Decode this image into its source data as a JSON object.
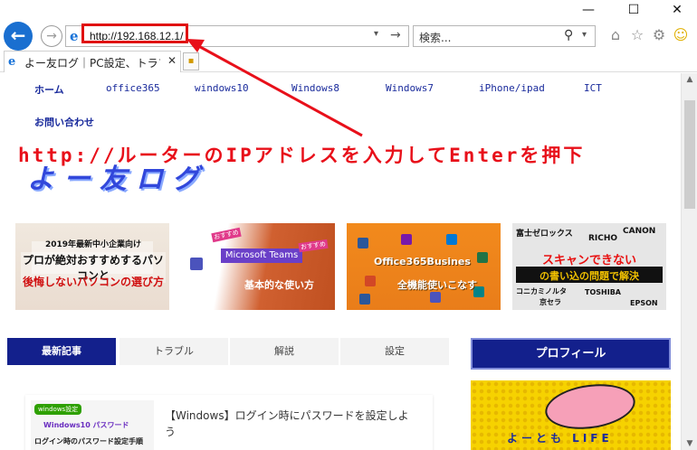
{
  "window": {
    "minimize": "—",
    "maximize": "☐",
    "close": "✕"
  },
  "toolbar": {
    "back": "←",
    "forward": "→",
    "url": "http://192.168.12.1/",
    "url_dropdown": "▾",
    "refresh": "→",
    "search_placeholder": "検索...",
    "search_icon": "⚲",
    "search_dropdown": "▾",
    "home_icon": "⌂",
    "favorites_icon": "☆",
    "settings_icon": "⚙",
    "feedback_icon": "☺"
  },
  "tab": {
    "title": "よー友ログ｜PC設定、トラブル...",
    "close": "✕",
    "new_tab": "▪"
  },
  "nav": {
    "items": [
      "ホーム",
      "office365",
      "windows10",
      "Windows8",
      "Windows7",
      "iPhone/ipad",
      "ICT"
    ],
    "contact": "お問い合わせ"
  },
  "annotation": {
    "text": "http://ルーターのIPアドレスを入力してEnterを押下",
    "color": "#e8101a"
  },
  "logo": {
    "text": "よー友ログ"
  },
  "thumbnails": {
    "t1": {
      "line1": "2019年最新中小企業向け",
      "line2": "プロが絶対おすすめするパソコンと",
      "line3": "後悔しないパソコンの選び方"
    },
    "t2": {
      "tag1": "おすすめ",
      "title": "Microsoft Teams",
      "tag2": "おすすめ",
      "subtitle": "基本的な使い方"
    },
    "t3": {
      "title": "Office365Busines",
      "subtitle": "全機能使いこなす"
    },
    "t4": {
      "brand1": "富士ゼロックス",
      "brand2": "RICHO",
      "brand3": "CANON",
      "title": "スキャンできない",
      "subtitle": "の書い込の問題で解決",
      "brand4": "コニカミノルタ",
      "brand5": "TOSHIBA",
      "brand6": "京セラ",
      "brand7": "EPSON"
    }
  },
  "content_tabs": [
    "最新記事",
    "トラブル",
    "解説",
    "設定"
  ],
  "profile": {
    "title": "プロフィール",
    "image_text": "よーとも LIFE"
  },
  "article": {
    "badge": "windows設定",
    "thumb_line1": "Windows10 パスワード",
    "thumb_line2": "ログイン時のパスワード設定手順",
    "title": "【Windows】ログイン時にパスワードを設定しよう"
  },
  "colors": {
    "brand_navy": "#13208c",
    "ie_blue": "#1a6fd0",
    "highlight_red": "#e01010"
  }
}
